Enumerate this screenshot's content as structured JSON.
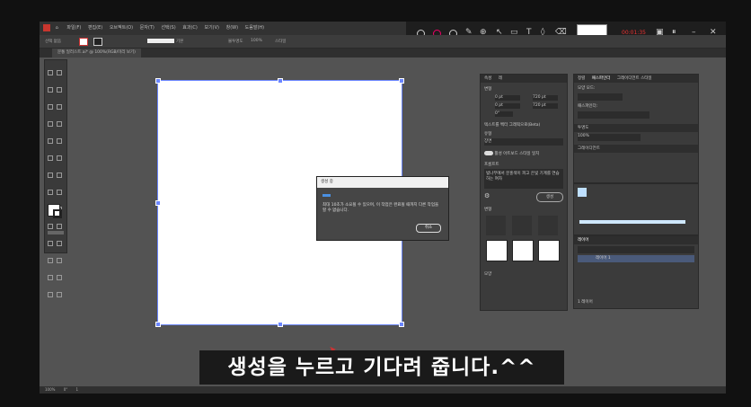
{
  "menubar": {
    "items": [
      "파일(F)",
      "편집(E)",
      "오브젝트(O)",
      "문자(T)",
      "선택(S)",
      "효과(C)",
      "보기(V)",
      "창(W)",
      "도움말(H)"
    ]
  },
  "control_bar": {
    "label": "선택 없음",
    "stroke_label": "기본",
    "opacity_label": "불투명도",
    "opacity_value": "100%",
    "style_label": "스타일"
  },
  "doc_tab": {
    "title": "문통 일러스트.ai* @ 100%(RGB/미리 보기)"
  },
  "float_toolbar": {
    "timer": "00:01:35"
  },
  "panels": {
    "properties_title": "속성",
    "properties_tab2": "레",
    "transform_label": "변형",
    "x_value": "0 pt",
    "y_value": "0 pt",
    "w_value": "720 pt",
    "h_value": "720 pt",
    "angle_value": "0°",
    "gen_label": "텍스트를 벡터 그래픽으로(Beta)",
    "subject_label": "유형",
    "subject_value": "장면",
    "toggle_label": "활성 아트보드 스타일 일치",
    "prompt_label": "프롬프트",
    "prompt_text": "벚나무에서 분홍색이 피고 은빛 기계를 연습하는 여자",
    "generate_button": "생성",
    "variations_label": "변형",
    "appearance_label": "모양",
    "pathfinder_title": "패스파인더",
    "pathfinder_tab1": "정렬",
    "gradient_tab": "그레이디언트 스타일",
    "shape_modes": "모양 모드:",
    "pathfinders": "패스파인더:",
    "transparency_tab": "투명도",
    "opacity_value": "100%",
    "gradient_title": "그레이디언트",
    "layers_tab": "레이어",
    "layer_name": "레이어 1",
    "layers_footer": "1 레이어"
  },
  "dialog": {
    "title": "생성 중",
    "message": "최대 10초가 소요될 수 있으며, 이 작업은 완료될 때까지 다른 작업을 할 수 없습니다.",
    "cancel": "취소",
    "progress": 0.07
  },
  "subtitle": {
    "text": "생성을 누르고 기다려 줍니다.^^"
  },
  "statusbar": {
    "zoom": "100%",
    "angle": "0°",
    "artboard": "1"
  }
}
